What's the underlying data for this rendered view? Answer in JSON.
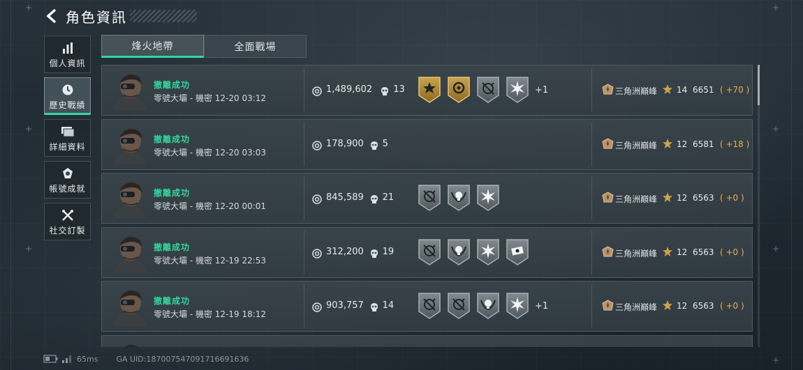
{
  "header": {
    "title": "角色資訊"
  },
  "sidebar": {
    "items": [
      {
        "label": "個人資訊",
        "icon": "bar-chart-icon",
        "active": false
      },
      {
        "label": "歷史戰績",
        "icon": "clock-icon",
        "active": true
      },
      {
        "label": "詳細資料",
        "icon": "folder-icon",
        "active": false
      },
      {
        "label": "帳號成就",
        "icon": "achievement-icon",
        "active": false
      },
      {
        "label": "社交訂製",
        "icon": "tools-icon",
        "active": false
      }
    ]
  },
  "tabs": [
    {
      "label": "烽火地帶",
      "active": true
    },
    {
      "label": "全面戰場",
      "active": false
    }
  ],
  "matches": [
    {
      "status": "撤離成功",
      "map": "零號大壩 - 機密",
      "time": "12-20 03:12",
      "money": "1,489,602",
      "kills": "13",
      "badges": [
        "gold-star-badge",
        "gold-emblem-badge",
        "crosshair-badge",
        "burst-badge"
      ],
      "extra": "+1",
      "rank": "三角洲巔峰",
      "level": "14",
      "score": "6651",
      "delta": "( +70 )"
    },
    {
      "status": "撤離成功",
      "map": "零號大壩 - 機密",
      "time": "12-20 03:03",
      "money": "178,900",
      "kills": "5",
      "badges": [],
      "extra": "",
      "rank": "三角洲巔峰",
      "level": "12",
      "score": "6581",
      "delta": "( +18 )"
    },
    {
      "status": "撤離成功",
      "map": "零號大壩 - 機密",
      "time": "12-20 00:01",
      "money": "845,589",
      "kills": "21",
      "badges": [
        "crosshair-badge",
        "skull-wing-badge",
        "burst-badge"
      ],
      "extra": "",
      "rank": "三角洲巔峰",
      "level": "12",
      "score": "6563",
      "delta": "( +0 )"
    },
    {
      "status": "撤離成功",
      "map": "零號大壩 - 機密",
      "time": "12-19 22:53",
      "money": "312,200",
      "kills": "19",
      "badges": [
        "crosshair-badge",
        "skull-wing-badge",
        "burst-badge",
        "cash-badge"
      ],
      "extra": "",
      "rank": "三角洲巔峰",
      "level": "12",
      "score": "6563",
      "delta": "( +0 )"
    },
    {
      "status": "撤離成功",
      "map": "零號大壩 - 機密",
      "time": "12-19 18:12",
      "money": "903,757",
      "kills": "14",
      "badges": [
        "crosshair-badge",
        "crosshair-badge",
        "skull-wing-badge",
        "burst-badge"
      ],
      "extra": "+1",
      "rank": "三角洲巔峰",
      "level": "12",
      "score": "6563",
      "delta": "( +0 )"
    }
  ],
  "footer": {
    "ping": "65ms",
    "uid": "GA UID:187007547091716691636"
  },
  "colors": {
    "accent": "#2fd8a4",
    "status": "#35d69d",
    "delta": "#e8b14a",
    "gold": "#c9a24a"
  }
}
